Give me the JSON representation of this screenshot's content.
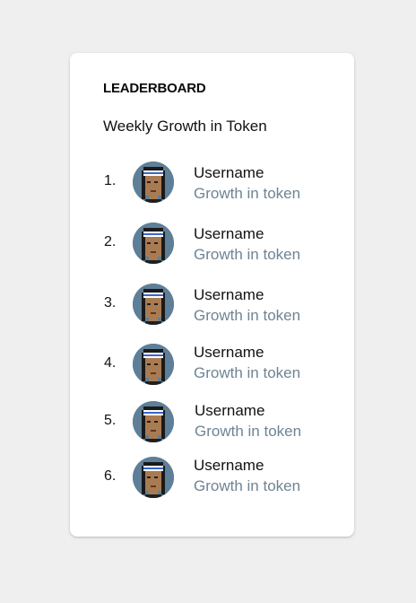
{
  "leaderboard": {
    "title": "LEADERBOARD",
    "subtitle": "Weekly Growth in Token",
    "entries": [
      {
        "rank": "1.",
        "username": "Username",
        "growth": "Growth in token",
        "avatar_icon": "pixel-punk-avatar-icon"
      },
      {
        "rank": "2.",
        "username": "Username",
        "growth": "Growth in token",
        "avatar_icon": "pixel-punk-avatar-icon"
      },
      {
        "rank": "3.",
        "username": "Username",
        "growth": "Growth in token",
        "avatar_icon": "pixel-punk-avatar-icon"
      },
      {
        "rank": "4.",
        "username": "Username",
        "growth": "Growth in token",
        "avatar_icon": "pixel-punk-avatar-icon"
      },
      {
        "rank": "5.",
        "username": "Username",
        "growth": "Growth in token",
        "avatar_icon": "pixel-punk-avatar-icon"
      },
      {
        "rank": "6.",
        "username": "Username",
        "growth": "Growth in token",
        "avatar_icon": "pixel-punk-avatar-icon"
      }
    ]
  },
  "colors": {
    "page_background": "#efefef",
    "card_background": "#ffffff",
    "primary_text": "#111111",
    "secondary_text": "#6e8494",
    "avatar_background": "#5e7f97"
  }
}
